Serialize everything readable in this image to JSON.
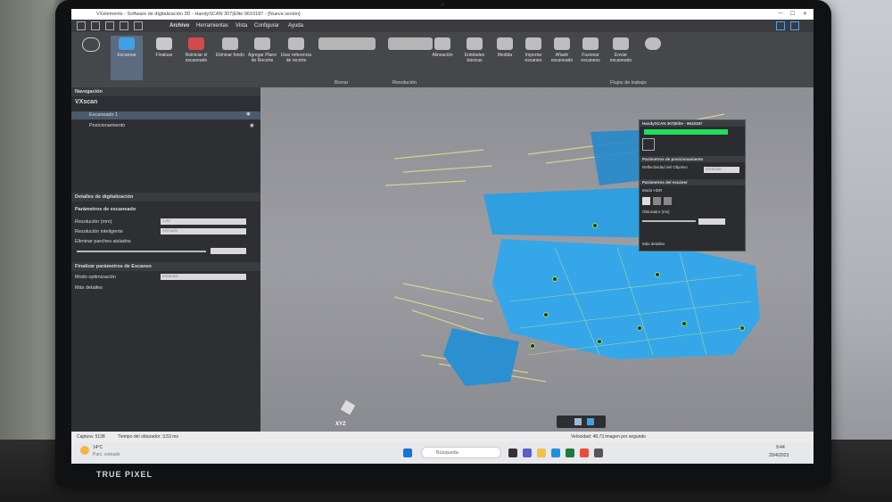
{
  "window": {
    "title": "VXelements - Software de digitalización 3D - HandySCAN 307|Elite 9610187 - [Nueva sesión]"
  },
  "menu": {
    "items": [
      "Archivo",
      "Herramientas",
      "Vista",
      "Configurar",
      "Ayuda"
    ]
  },
  "ribbon": {
    "tools": [
      {
        "label": "Escanear"
      },
      {
        "label": "Finalizar"
      },
      {
        "label": "Reiniciar el escaneado"
      },
      {
        "label": "Eliminar fondo"
      },
      {
        "label": "Agregar Plano de Recorte"
      },
      {
        "label": "Usar referencia de recorte"
      },
      {
        "label": "Alineación"
      },
      {
        "label": "Entidades básicas"
      },
      {
        "label": "Medida"
      },
      {
        "label": "Importar escaneo"
      },
      {
        "label": "Añadir escaneado"
      },
      {
        "label": "Fusionar escaneos"
      },
      {
        "label": "Enviar escaneado"
      }
    ],
    "groups": [
      "Borrar",
      "Resolución",
      "Flujos de trabajo"
    ]
  },
  "navigation": {
    "header": "Navegación",
    "root": "VXscan",
    "items": [
      "Escaneado 1",
      "Posicionamiento"
    ]
  },
  "details": {
    "header": "Detalles de digitalización",
    "params_header": "Parámetros de escaneado",
    "rows": [
      {
        "label": "Resolución (mm)",
        "value": "1.00"
      },
      {
        "label": "Resolución inteligente",
        "value": "Activado"
      },
      {
        "label": "Eliminar parches aislados",
        "value": ""
      }
    ],
    "final_header": "Finalizar parámetros de Escaneo",
    "final_rows": [
      {
        "label": "Modo optimización",
        "value": "Estándar"
      }
    ],
    "more": "Más detalles"
  },
  "scanner_panel": {
    "device": "HandySCAN 307|Elite - 9610187",
    "pos_header": "Parámetros de posicionamiento",
    "reflectivity": "Reflectividad del Objetivo",
    "reflectivity_value": "Estándar",
    "scanner_header": "Parámetros del escáner",
    "hdr": "Modo HDR",
    "shutter": "Obturador (ms)",
    "more": "Más detalles"
  },
  "viewport": {
    "axis_label": "XYZ"
  },
  "statusbar": {
    "capture": "Captura: 5138",
    "shutter": "Tiempo del obturador: 3,53 ms",
    "velocity": "Velocidad: 48,73 imagen por segundo"
  },
  "taskbar": {
    "search_placeholder": "Búsqueda",
    "weather_temp": "14°C",
    "weather_desc": "Parc. soleado",
    "clock_time": "9:44",
    "clock_date": "20/4/2023"
  },
  "bezel": {
    "brand": "TRUE PIXEL"
  }
}
